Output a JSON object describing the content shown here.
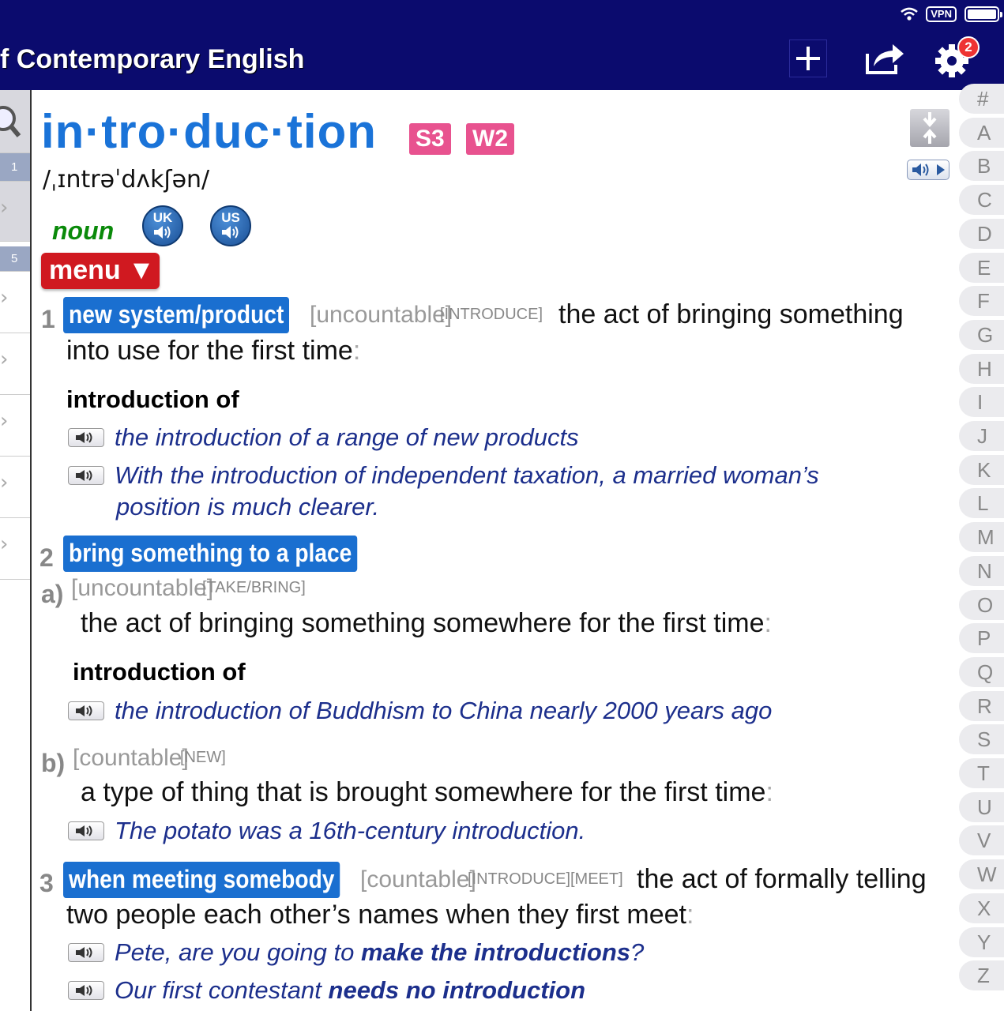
{
  "status": {
    "vpn": "VPN"
  },
  "header": {
    "title": "f Contemporary English",
    "settings_badge": "2"
  },
  "leftlist": {
    "section_1": "1",
    "section_5": "5"
  },
  "entry": {
    "headword": "in·tro·duc·tion",
    "frequency": [
      "S3",
      "W2"
    ],
    "pronunciation": "/ˌɪntrəˈdʌkʃən/",
    "part_of_speech": "noun",
    "audio": {
      "uk": "UK",
      "us": "US"
    },
    "menu_label": "menu ▼",
    "senses": [
      {
        "num": "1",
        "signpost": "new system/product",
        "grammar": "[uncountable]",
        "register": "[INTRODUCE]",
        "def_line1": "the act of bringing something",
        "def_line2": "into use for the first time",
        "collocation": "introduction of",
        "examples": [
          "the introduction of a range of new products",
          "With the introduction of independent taxation, a married woman’s",
          "position is much clearer."
        ]
      },
      {
        "num": "2",
        "signpost": "bring something to a place",
        "a": {
          "label": "a)",
          "grammar": "[uncountable]",
          "register": "[TAKE/BRING]",
          "def": "the act of bringing something somewhere for the first time",
          "collocation": "introduction of",
          "example": "the introduction of Buddhism to China nearly 2000 years ago"
        },
        "b": {
          "label": "b)",
          "grammar": "[countable]",
          "register": "[NEW]",
          "def": "a type of thing that is brought somewhere for the first time",
          "example": "The potato was a 16th-century introduction."
        }
      },
      {
        "num": "3",
        "signpost": "when meeting somebody",
        "grammar": "[countable]",
        "register": "[INTRODUCE][MEET]",
        "def_line1": "the act of formally telling",
        "def_line2": "two people each other’s names when they first meet",
        "ex1_pre": "Pete, are you going to",
        "ex1_bold": "make the introductions",
        "ex1_post": "?",
        "ex2_pre": "Our first contestant",
        "ex2_bold": "needs no introduction"
      }
    ],
    "colon": ":"
  },
  "alphabet": [
    "#",
    "A",
    "B",
    "C",
    "D",
    "E",
    "F",
    "G",
    "H",
    "I",
    "J",
    "K",
    "L",
    "M",
    "N",
    "O",
    "P",
    "Q",
    "R",
    "S",
    "T",
    "U",
    "V",
    "W",
    "X",
    "Y",
    "Z"
  ],
  "colors": {
    "header_bg": "#0b0b6e",
    "headword": "#1a73d8",
    "signpost": "#1a6fd0",
    "freq_badge": "#e8528f",
    "menu": "#d01920",
    "example": "#1c2f8c",
    "pos": "#0a8a0a"
  }
}
